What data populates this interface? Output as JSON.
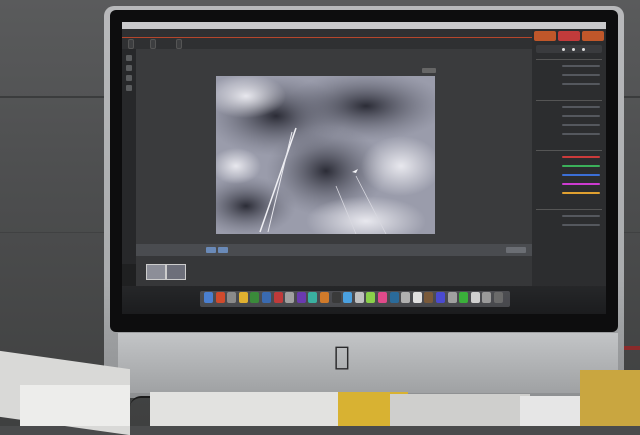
{
  "scene": {
    "description_hidden": "",
    "imac": {
      "logo": "apple-logo"
    }
  },
  "app": {
    "menubar_items": [
      "",
      "",
      "",
      "",
      "",
      "",
      "",
      "",
      ""
    ],
    "toolbar_buttons": [
      "",
      "",
      ""
    ],
    "photo_title": "",
    "filmstrip_label": "",
    "right_panel": {
      "tabs": [
        {
          "color": "#c0572a"
        },
        {
          "color": "#c23b3b"
        },
        {
          "color": "#c0572a"
        }
      ],
      "sections": [
        {
          "rows": 3
        },
        {
          "rows": 4
        },
        {
          "rows": 5
        },
        {
          "rows": 2
        }
      ],
      "slider_colors": [
        "#cc3b3b",
        "#3bb05a",
        "#3b6fd6",
        "#cc3bd0",
        "#e0a030"
      ]
    },
    "dock_colors": [
      "#4a7fd0",
      "#d04a2c",
      "#8a8a8a",
      "#e0b030",
      "#3a8a3a",
      "#3a6ab0",
      "#c03a3a",
      "#a0a0a0",
      "#6a3ab0",
      "#3ab0a0",
      "#d07a2a",
      "#3a3a3a",
      "#4aa0e0",
      "#c0c0c0",
      "#8ad04a",
      "#e04a8a",
      "#2a6a9a",
      "#b0b0b0",
      "#e0e0e0",
      "#7a5a3a",
      "#4a4ad0",
      "#a0a0a0",
      "#3ab03a",
      "#d0d0d0",
      "#9a9a9a",
      "#6a6a6a"
    ]
  }
}
